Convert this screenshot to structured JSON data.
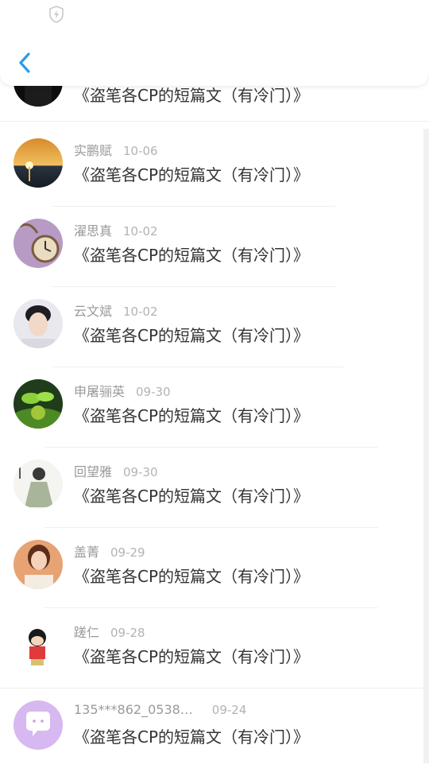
{
  "header": {
    "back_icon": "chevron-left-icon",
    "status_icon": "shield-lightning-icon",
    "accent": "#2a9bea"
  },
  "comments": [
    {
      "user": "",
      "date": "",
      "title": "《盗笔各CP的短篇文（有冷门）》"
    },
    {
      "user": "实鹏赋",
      "date": "10-06",
      "title": "《盗笔各CP的短篇文（有冷门）》"
    },
    {
      "user": "濯思真",
      "date": "10-02",
      "title": "《盗笔各CP的短篇文（有冷门）》"
    },
    {
      "user": "云文斌",
      "date": "10-02",
      "title": "《盗笔各CP的短篇文（有冷门）》"
    },
    {
      "user": "申屠骊英",
      "date": "09-30",
      "title": "《盗笔各CP的短篇文（有冷门）》"
    },
    {
      "user": "回望雅",
      "date": "09-30",
      "title": "《盗笔各CP的短篇文（有冷门）》"
    },
    {
      "user": "盖菁",
      "date": "09-29",
      "title": "《盗笔各CP的短篇文（有冷门）》"
    },
    {
      "user": "蹉仁",
      "date": "09-28",
      "title": "《盗笔各CP的短篇文（有冷门）》"
    },
    {
      "user": "135***862_0538…",
      "date": "09-24",
      "title": "《盗笔各CP的短篇文（有冷门）》"
    }
  ]
}
